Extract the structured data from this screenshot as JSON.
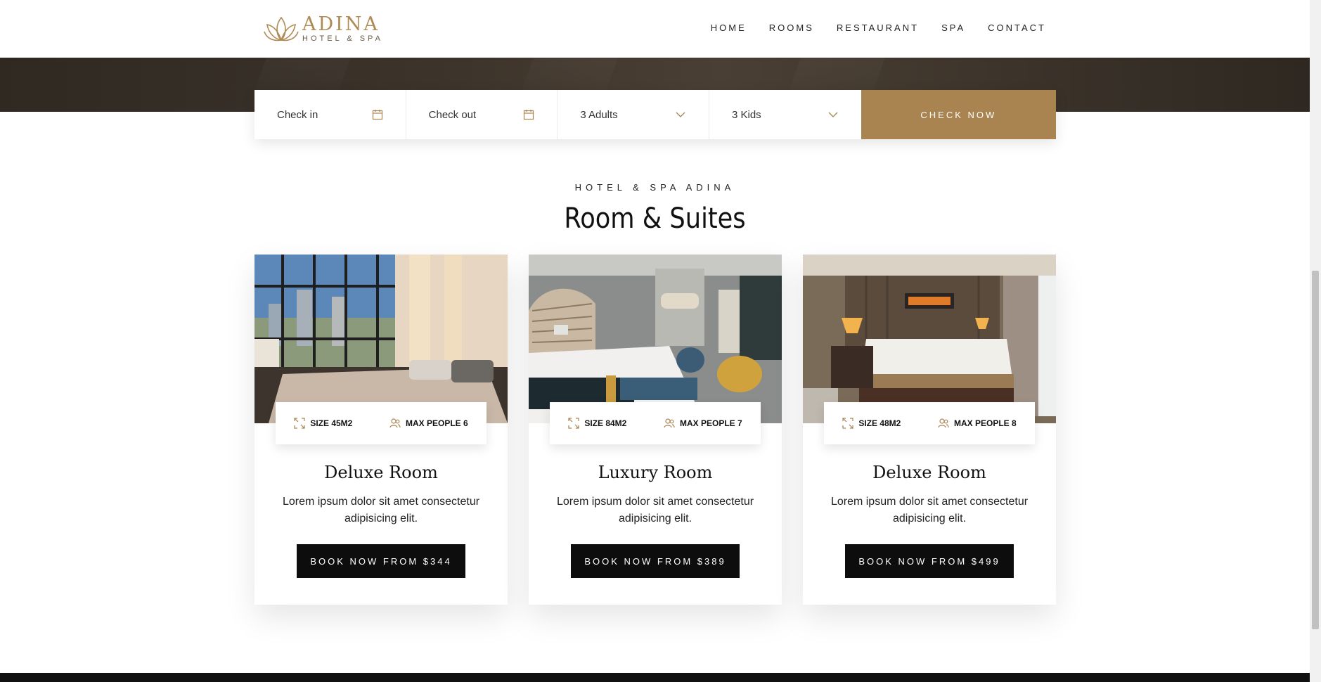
{
  "brand": {
    "name": "ADINA",
    "tagline": "HOTEL & SPA",
    "accent": "#a98350"
  },
  "nav": {
    "items": [
      "HOME",
      "ROOMS",
      "RESTAURANT",
      "SPA",
      "CONTACT"
    ]
  },
  "booking": {
    "checkin": "Check in",
    "checkout": "Check out",
    "adults": "3 Adults",
    "kids": "3 Kids",
    "submit": "CHECK NOW"
  },
  "section": {
    "kicker": "HOTEL & SPA ADINA",
    "title": "Room & Suites"
  },
  "rooms": [
    {
      "size": "SIZE 45M2",
      "people": "MAX PEOPLE 6",
      "name": "Deluxe Room",
      "desc": "Lorem ipsum dolor sit amet consectetur adipisicing elit.",
      "cta": "BOOK NOW FROM $344"
    },
    {
      "size": "SIZE 84M2",
      "people": "MAX PEOPLE 7",
      "name": "Luxury Room",
      "desc": "Lorem ipsum dolor sit amet consectetur adipisicing elit.",
      "cta": "BOOK NOW FROM $389"
    },
    {
      "size": "SIZE 48M2",
      "people": "MAX PEOPLE 8",
      "name": "Deluxe Room",
      "desc": "Lorem ipsum dolor sit amet consectetur adipisicing elit.",
      "cta": "BOOK NOW FROM $499"
    }
  ],
  "icons": {
    "calendar": "calendar-icon",
    "chevron": "chevron-down-icon",
    "size": "expand-icon",
    "people": "users-icon",
    "logo": "lotus-icon"
  }
}
